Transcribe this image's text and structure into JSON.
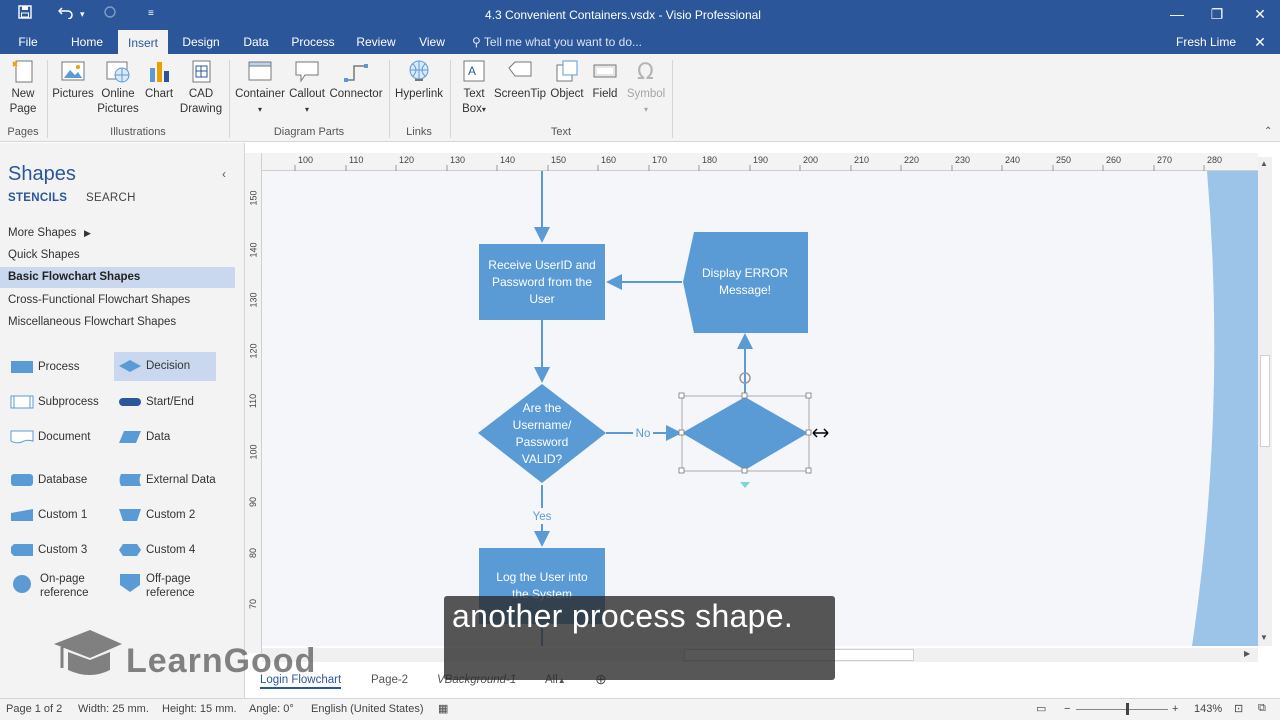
{
  "app": {
    "title": "4.3 Convenient Containers.vsdx - Visio Professional",
    "user": "Fresh Lime",
    "tell_me_placeholder": "Tell me what you want to do..."
  },
  "ribbon_tabs": [
    "File",
    "Home",
    "Insert",
    "Design",
    "Data",
    "Process",
    "Review",
    "View"
  ],
  "ribbon_active_tab": "Insert",
  "ribbon": {
    "pages": {
      "label": "Pages",
      "new_page": [
        "New",
        "Page"
      ]
    },
    "illustrations": {
      "label": "Illustrations",
      "pictures": "Pictures",
      "online_pictures": [
        "Online",
        "Pictures"
      ],
      "chart": "Chart",
      "cad_drawing": [
        "CAD",
        "Drawing"
      ]
    },
    "diagram_parts": {
      "label": "Diagram Parts",
      "container": "Container",
      "callout": "Callout",
      "connector": "Connector"
    },
    "links": {
      "label": "Links",
      "hyperlink": "Hyperlink"
    },
    "text": {
      "label": "Text",
      "text_box": [
        "Text",
        "Box"
      ],
      "screentip": "ScreenTip",
      "object": "Object",
      "field": "Field",
      "symbol": "Symbol"
    }
  },
  "shapes_pane": {
    "title": "Shapes",
    "tabs": [
      "STENCILS",
      "SEARCH"
    ],
    "stencils": [
      "More Shapes",
      "Quick Shapes",
      "Basic Flowchart Shapes",
      "Cross-Functional Flowchart Shapes",
      "Miscellaneous Flowchart Shapes"
    ],
    "selected_stencil": "Basic Flowchart Shapes",
    "masters": [
      [
        "Process",
        "Decision"
      ],
      [
        "Subprocess",
        "Start/End"
      ],
      [
        "Document",
        "Data"
      ],
      [
        "Database",
        "External Data"
      ],
      [
        "Custom 1",
        "Custom 2"
      ],
      [
        "Custom 3",
        "Custom 4"
      ],
      [
        [
          "On-page",
          "reference"
        ],
        [
          "Off-page",
          "reference"
        ]
      ]
    ],
    "selected_master": "Decision"
  },
  "ruler": {
    "top_ticks": [
      "100",
      "110",
      "120",
      "130",
      "140",
      "150",
      "160",
      "170",
      "180",
      "190",
      "200",
      "210",
      "220",
      "230",
      "240",
      "250",
      "260",
      "270",
      "280"
    ],
    "left_ticks": [
      "150",
      "140",
      "130",
      "120",
      "110",
      "100",
      "90",
      "80",
      "70"
    ]
  },
  "diagram": {
    "receive": [
      "Receive UserID and",
      "Password from the",
      "User"
    ],
    "error": [
      "Display ERROR",
      "Message!"
    ],
    "decision": [
      "Are the",
      "Username/",
      "Password",
      "VALID?"
    ],
    "no_label": "No",
    "yes_label": "Yes",
    "log": [
      "Log the User into",
      "the System"
    ]
  },
  "page_tabs": [
    "Login Flowchart",
    "Page-2",
    "VBackground-1",
    "All"
  ],
  "active_page": "Login Flowchart",
  "status": {
    "page": "Page 1 of 2",
    "width": "Width: 25 mm.",
    "height": "Height: 15 mm.",
    "angle": "Angle: 0°",
    "language": "English (United States)",
    "zoom": "143%"
  },
  "caption": "another process shape.",
  "watermark": "LearnGood",
  "colors": {
    "brand": "#2b579a",
    "shape_fill": "#5b9bd5",
    "connector": "#5b9bd5",
    "selected_stencil": "#c9d7ef"
  }
}
